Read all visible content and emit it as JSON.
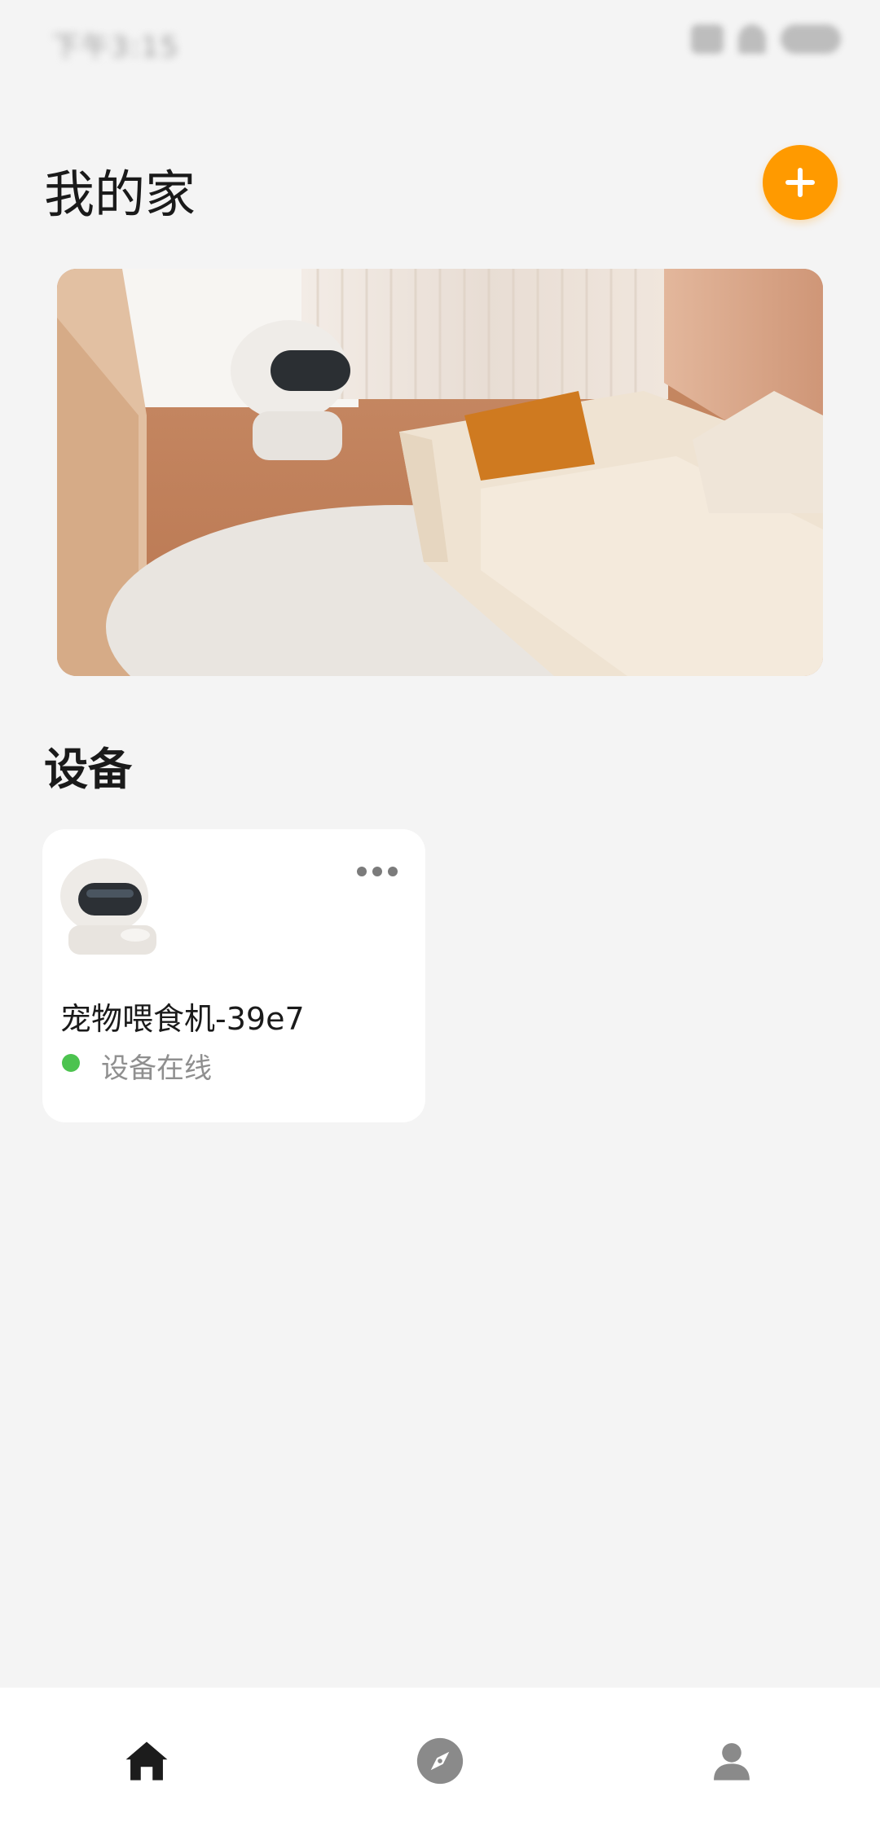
{
  "status_bar": {
    "time": "下午3:15",
    "icons": [
      "sim-icon",
      "wifi-icon",
      "battery-icon"
    ]
  },
  "header": {
    "title": "我的家",
    "add_icon": "plus-icon",
    "accent_color": "#ff9a00"
  },
  "section": {
    "devices_title": "设备"
  },
  "devices": [
    {
      "name": "宠物喂食机-39e7",
      "status": "设备在线",
      "status_color": "#4cc34f",
      "menu_icon": "more-icon"
    }
  ],
  "bottom_nav": {
    "items": [
      {
        "icon": "home-icon",
        "active": true
      },
      {
        "icon": "compass-icon",
        "active": false
      },
      {
        "icon": "user-icon",
        "active": false
      }
    ]
  }
}
